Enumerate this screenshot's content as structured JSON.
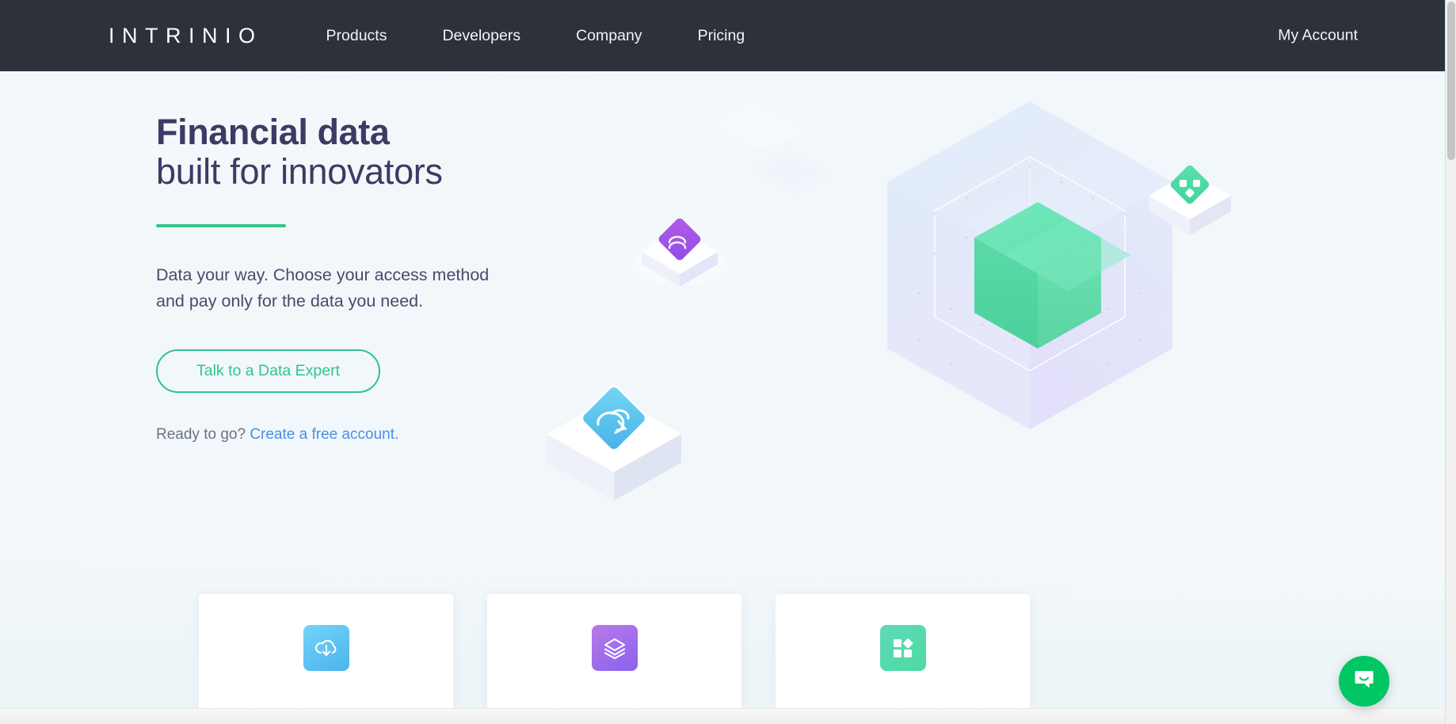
{
  "brand": {
    "name": "INTRINIO"
  },
  "nav": {
    "links": [
      {
        "label": "Products"
      },
      {
        "label": "Developers"
      },
      {
        "label": "Company"
      },
      {
        "label": "Pricing"
      }
    ],
    "account_label": "My Account"
  },
  "hero": {
    "headline_line1": "Financial data",
    "headline_line2": "built for innovators",
    "subtext": "Data your way. Choose your access method and pay only for the data you need.",
    "cta_label": "Talk to a Data Expert",
    "ready_prefix": "Ready to go? ",
    "ready_link": "Create a free account.",
    "accent_color": "#32c48d",
    "link_color": "#4a90e2",
    "headline_color": "#3b3b63"
  },
  "illustration": {
    "cube_label": "isometric-data-cube",
    "tiles": [
      {
        "name": "purple-tile",
        "icon": "api-icon",
        "color": "#9b4fe0"
      },
      {
        "name": "green-tile",
        "icon": "network-nodes-icon",
        "color": "#4ed8a6"
      },
      {
        "name": "blue-tile",
        "icon": "cloud-sync-icon",
        "color": "#45b6ea"
      }
    ],
    "inner_cube_color": "#4ede9e",
    "outer_cube_color": "#d8e4f7"
  },
  "cards": [
    {
      "icon": "cloud-download-icon",
      "accent": "#4bb4ef",
      "name": "card-bulk-download"
    },
    {
      "icon": "layers-icon",
      "accent": "#8b62ee",
      "name": "card-data-feeds"
    },
    {
      "icon": "apps-grid-icon",
      "accent": "#4ddba0",
      "name": "card-applications"
    }
  ],
  "chat": {
    "icon": "chat-bubble-icon",
    "color": "#00c663"
  },
  "scrollbar": {
    "name": "vertical-scrollbar"
  }
}
